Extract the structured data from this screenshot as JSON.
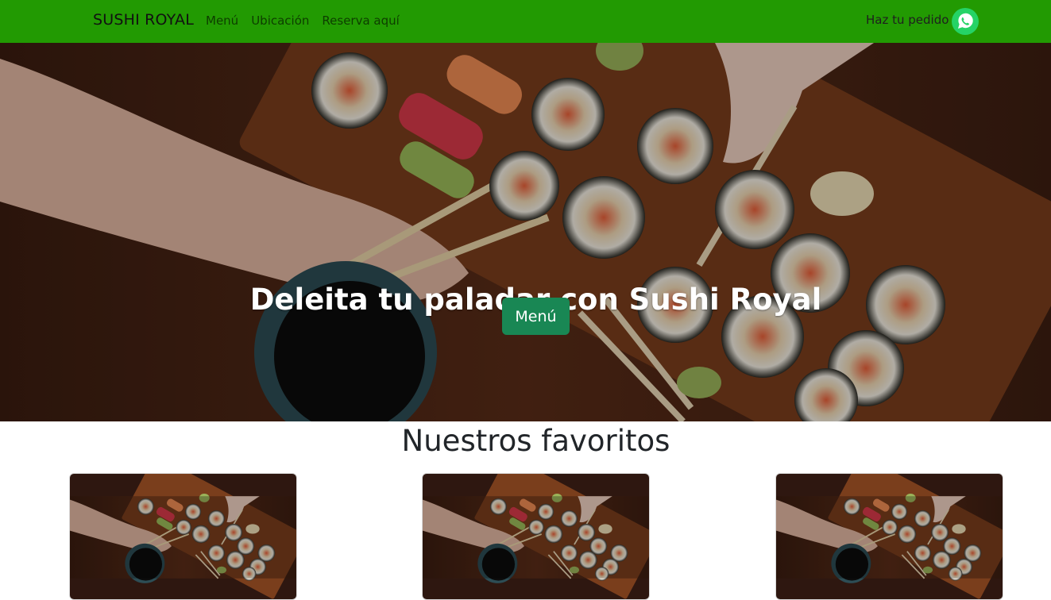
{
  "navbar": {
    "brand": "SUSHI ROYAL",
    "links": [
      {
        "label": "Menú"
      },
      {
        "label": "Ubicación"
      },
      {
        "label": "Reserva aquí"
      }
    ],
    "order_label": "Haz tu pedido",
    "order_icon": "whatsapp-icon"
  },
  "hero": {
    "title": "Deleita tu paladar con Sushi Royal",
    "button_label": "Menú",
    "image": "sushi-platter-photo"
  },
  "favorites": {
    "title": "Nuestros favoritos",
    "cards": [
      {
        "image": "sushi-platter-photo"
      },
      {
        "image": "sushi-platter-photo"
      },
      {
        "image": "sushi-platter-photo"
      }
    ]
  },
  "colors": {
    "navbar_bg": "#229a02",
    "button_bg": "#198754",
    "whatsapp": "#25d366"
  }
}
